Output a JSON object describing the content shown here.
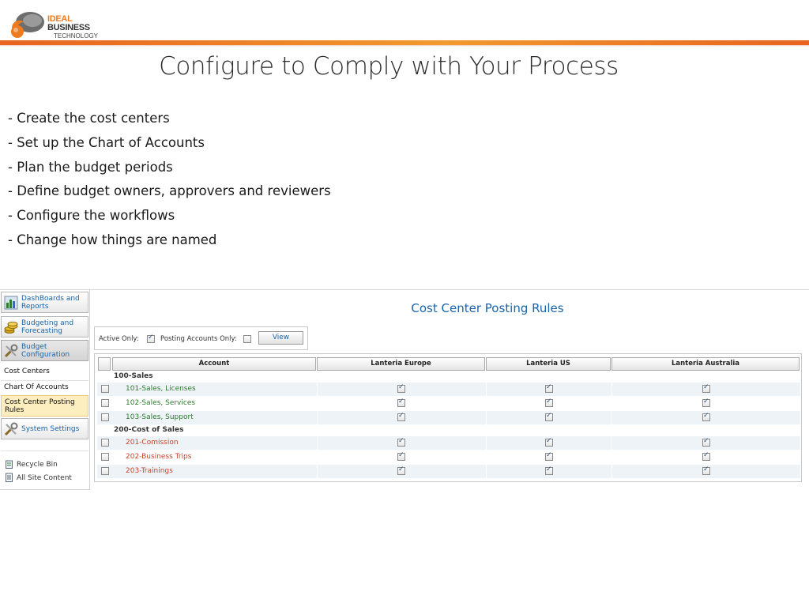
{
  "logo": {
    "brand_word1": "IDEAL",
    "brand_word2": " BUSINESS",
    "brand_line2": "TECHNOLOGY",
    "accent_color": "#f07a1e"
  },
  "slide": {
    "title": "Configure to Comply with Your Process",
    "bullets": [
      "- Create the cost centers",
      "- Set up the Chart of Accounts",
      "- Plan the budget periods",
      "- Define budget owners, approvers and reviewers",
      "- Configure the workflows",
      "- Change how things are named"
    ]
  },
  "sidebar": {
    "items": [
      {
        "label": "DashBoards and Reports",
        "icon": "chart-icon"
      },
      {
        "label": "Budgeting and Forecasting",
        "icon": "coins-icon"
      },
      {
        "label": "Budget Configuration",
        "icon": "tools-icon"
      }
    ],
    "subitems": [
      "Cost Centers",
      "Chart Of Accounts",
      "Cost Center Posting Rules"
    ],
    "settings": {
      "label": "System Settings",
      "icon": "tools-icon"
    },
    "links": [
      {
        "label": "Recycle Bin",
        "icon": "recycle-bin-icon"
      },
      {
        "label": "All Site Content",
        "icon": "site-content-icon"
      }
    ]
  },
  "page": {
    "heading": "Cost Center Posting Rules",
    "filters": {
      "active_only_label": "Active Only:",
      "active_only_checked": true,
      "posting_only_label": "Posting Accounts Only:",
      "posting_only_checked": false,
      "view_label": "View"
    },
    "grid": {
      "columns": [
        "Account",
        "Lanteria Europe",
        "Lanteria US",
        "Lanteria Australia"
      ],
      "groups": [
        {
          "name": "100-Sales",
          "color": "#2d7a2d",
          "rows": [
            {
              "account": "101-Sales, Licenses",
              "europe": true,
              "us": true,
              "australia": true
            },
            {
              "account": "102-Sales, Services",
              "europe": true,
              "us": true,
              "australia": true
            },
            {
              "account": "103-Sales, Support",
              "europe": true,
              "us": true,
              "australia": true
            }
          ]
        },
        {
          "name": "200-Cost of Sales",
          "color": "#c0472b",
          "rows": [
            {
              "account": "201-Comission",
              "europe": true,
              "us": true,
              "australia": true
            },
            {
              "account": "202-Business Trips",
              "europe": true,
              "us": true,
              "australia": true
            },
            {
              "account": "203-Trainings",
              "europe": true,
              "us": true,
              "australia": true
            }
          ]
        }
      ]
    }
  }
}
